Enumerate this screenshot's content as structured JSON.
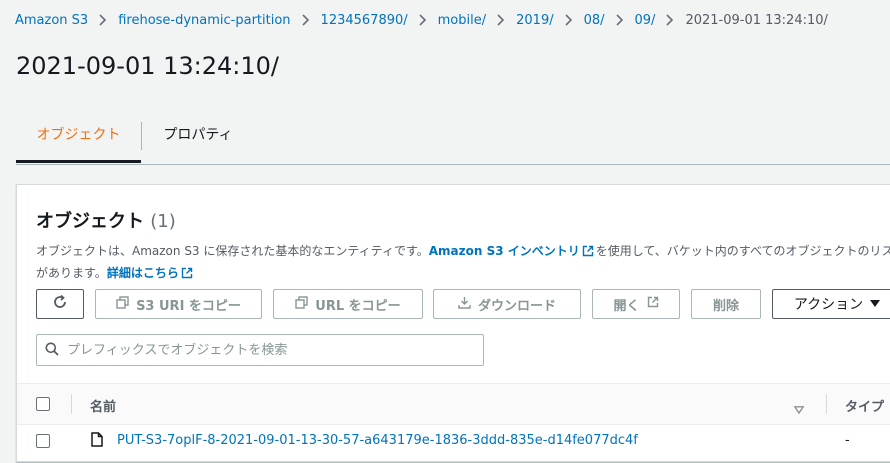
{
  "breadcrumb": [
    {
      "label": "Amazon S3"
    },
    {
      "label": "firehose-dynamic-partition"
    },
    {
      "label": "1234567890/"
    },
    {
      "label": "mobile/"
    },
    {
      "label": "2019/"
    },
    {
      "label": "08/"
    },
    {
      "label": "09/"
    },
    {
      "label": "2021-09-01 13:24:10/"
    }
  ],
  "page": {
    "title": "2021-09-01 13:24:10/"
  },
  "tabs": {
    "objects": "オブジェクト",
    "properties": "プロパティ"
  },
  "panel": {
    "title": "オブジェクト",
    "count": "(1)",
    "desc_part1": "オブジェクトは、Amazon S3 に保存された基本的なエンティティです。",
    "inventory_link": "Amazon S3 インベントリ",
    "desc_part2": "を使用して、バケット内のすべてのオブジェクトのリスト",
    "desc_line2": "があります。",
    "learn_more": "詳細はこちら"
  },
  "toolbar": {
    "copy_s3_uri": "S3 URI をコピー",
    "copy_url": "URL をコピー",
    "download": "ダウンロード",
    "open": "開く",
    "delete": "削除",
    "actions": "アクション"
  },
  "search": {
    "placeholder": "プレフィックスでオブジェクトを検索",
    "value": ""
  },
  "table": {
    "columns": {
      "name": "名前",
      "type": "タイプ"
    },
    "rows": [
      {
        "name": "PUT-S3-7oplF-8-2021-09-01-13-30-57-a643179e-1836-3ddd-835e-d14fe077dc4f",
        "type": "-"
      }
    ]
  },
  "colors": {
    "accent": "#ec7211",
    "link": "#0073bb",
    "text": "#16191f"
  }
}
